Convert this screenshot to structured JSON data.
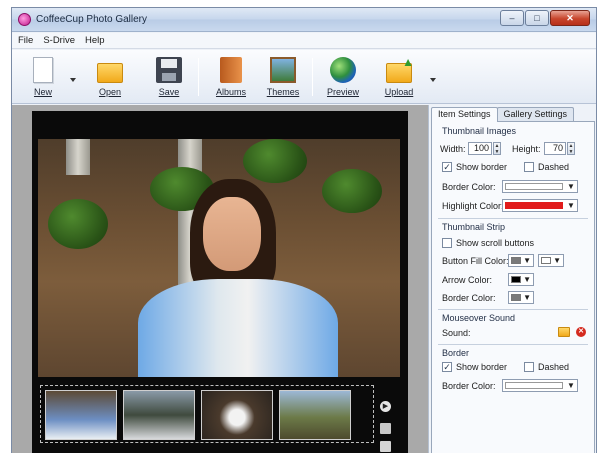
{
  "window": {
    "title": "CoffeeCup Photo Gallery"
  },
  "window_controls": {
    "minimize": "–",
    "maximize": "□",
    "close": "✕"
  },
  "menu": [
    "File",
    "S-Drive",
    "Help"
  ],
  "toolbar": {
    "new": "New",
    "open": "Open",
    "save": "Save",
    "albums": "Albums",
    "themes": "Themes",
    "preview": "Preview",
    "upload": "Upload"
  },
  "tabs": {
    "item_settings": "Item Settings",
    "gallery_settings": "Gallery Settings"
  },
  "thumbnail_images": {
    "title": "Thumbnail Images",
    "width_label": "Width:",
    "width_value": "100",
    "height_label": "Height:",
    "height_value": "70",
    "show_border": "Show border",
    "show_border_checked": true,
    "dashed": "Dashed",
    "dashed_checked": false,
    "border_color_label": "Border Color:",
    "border_color": "#ffffff",
    "highlight_color_label": "Highlight Color:",
    "highlight_color": "#e11b1b"
  },
  "thumbnail_strip": {
    "title": "Thumbnail Strip",
    "show_scroll_buttons": "Show scroll buttons",
    "show_scroll_buttons_checked": false,
    "button_fill_label": "Button Fill Color:",
    "button_fill_color": "#7a7a7a",
    "button_fill_color2": "#ffffff",
    "arrow_color_label": "Arrow Color:",
    "arrow_color": "#000000",
    "border_color_label": "Border Color:",
    "border_color": "#7a7a7a"
  },
  "mouseover_sound": {
    "title": "Mouseover Sound",
    "sound_label": "Sound:"
  },
  "border": {
    "title": "Border",
    "show_border": "Show border",
    "show_border_checked": true,
    "dashed": "Dashed",
    "dashed_checked": false,
    "border_color_label": "Border Color:",
    "border_color": "#ffffff"
  },
  "icons": {
    "app": "coffeecup-app-icon",
    "new": "new-document-icon",
    "open": "open-folder-icon",
    "save": "floppy-disk-icon",
    "albums": "album-book-icon",
    "themes": "themes-picture-icon",
    "preview": "globe-icon",
    "upload": "upload-folder-icon"
  }
}
